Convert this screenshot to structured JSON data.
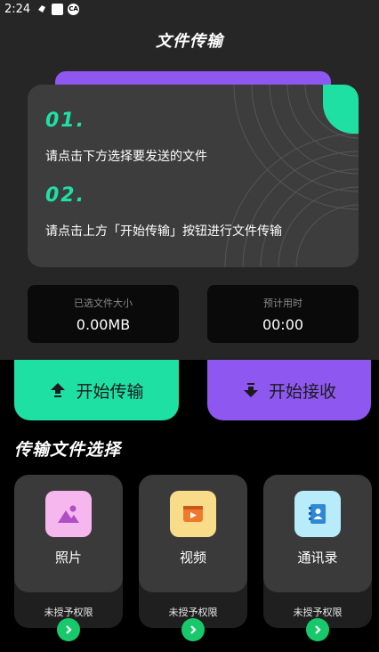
{
  "status_bar": {
    "time": "2:24"
  },
  "header": {
    "title": "文件传输"
  },
  "info_card": {
    "steps": [
      {
        "num": "01.",
        "text": "请点击下方选择要发送的文件"
      },
      {
        "num": "02.",
        "text": "请点击上方「开始传输」按钮进行文件传输"
      }
    ]
  },
  "stats": {
    "selected_size_label": "已选文件大小",
    "selected_size_value": "0.00MB",
    "estimate_label": "预计用时",
    "estimate_value": "00:00"
  },
  "actions": {
    "send_label": "开始传输",
    "receive_label": "开始接收"
  },
  "section": {
    "title": "传输文件选择"
  },
  "file_types": [
    {
      "name": "照片",
      "permission": "未授予权限",
      "icon": "photo-icon",
      "color": "#f6b6ee"
    },
    {
      "name": "视频",
      "permission": "未授予权限",
      "icon": "video-icon",
      "color": "#f9dc8a"
    },
    {
      "name": "通讯录",
      "permission": "未授予权限",
      "icon": "contacts-icon",
      "color": "#b9ecfb"
    }
  ],
  "colors": {
    "accent_green": "#1fe0a3",
    "accent_purple": "#8e58f0",
    "go_green": "#18c96b"
  }
}
